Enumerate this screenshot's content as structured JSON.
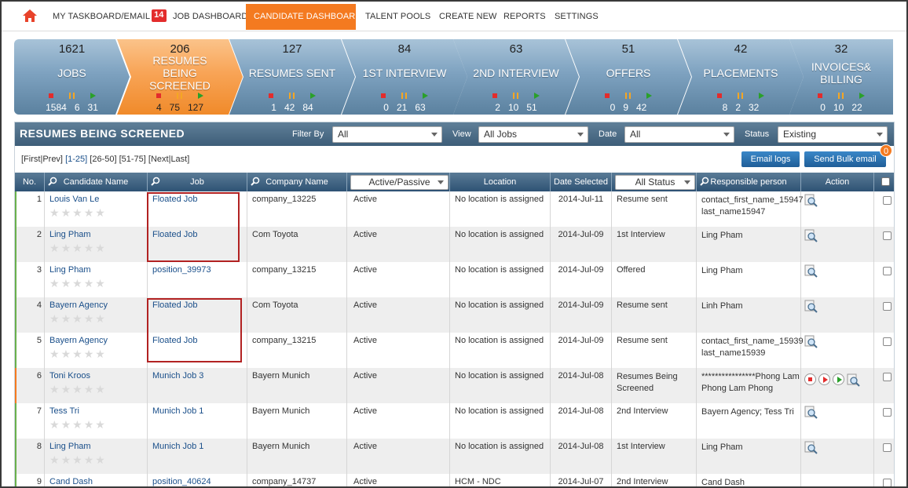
{
  "nav": {
    "items": [
      {
        "label": "MY TASKBOARD/EMAIL",
        "badge": "14"
      },
      {
        "label": "JOB DASHBOARD"
      },
      {
        "label": "CANDIDATE DASHBOARD"
      },
      {
        "label": "TALENT POOLS"
      },
      {
        "label": "CREATE NEW"
      },
      {
        "label": "REPORTS"
      },
      {
        "label": "SETTINGS"
      }
    ],
    "active_item": "CANDIDATE DASHBOARD",
    "accent_color": "#f47a20"
  },
  "pipeline": [
    {
      "count": "1621",
      "label": "JOBS",
      "stopped": "1584",
      "paused": "6",
      "running": "31"
    },
    {
      "count": "206",
      "label": "RESUMES BEING SCREENED",
      "stopped": "4",
      "paused": "75",
      "running": "127",
      "active": true
    },
    {
      "count": "127",
      "label": "RESUMES SENT",
      "stopped": "1",
      "paused": "42",
      "running": "84"
    },
    {
      "count": "84",
      "label": "1ST INTERVIEW",
      "stopped": "0",
      "paused": "21",
      "running": "63"
    },
    {
      "count": "63",
      "label": "2ND INTERVIEW",
      "stopped": "2",
      "paused": "10",
      "running": "51"
    },
    {
      "count": "51",
      "label": "OFFERS",
      "stopped": "0",
      "paused": "9",
      "running": "42"
    },
    {
      "count": "42",
      "label": "PLACEMENTS",
      "stopped": "8",
      "paused": "2",
      "running": "32"
    },
    {
      "count": "32",
      "label": "INVOICES& BILLING",
      "stopped": "0",
      "paused": "10",
      "running": "22"
    }
  ],
  "panel": {
    "title": "RESUMES BEING SCREENED",
    "filter_by_label": "Filter By",
    "filter_by_value": "All",
    "view_label": "View",
    "view_value": "All Jobs",
    "date_label": "Date",
    "date_value": "All",
    "status_label": "Status",
    "status_value": "Existing"
  },
  "pager": {
    "first": "[First",
    "sep": "|",
    "prev": "Prev]",
    "range1": "[1-25]",
    "range2": "[26-50]",
    "range3": "[51-75]",
    "next": "[Next",
    "last": "Last]"
  },
  "buttons": {
    "email_logs": "Email logs",
    "send_bulk_email": "Send Bulk email",
    "bulk_badge": "0"
  },
  "table": {
    "headers": {
      "no": "No.",
      "candidate": "Candidate Name",
      "job": "Job",
      "company": "Company Name",
      "active_passive": "Active/Passive",
      "location": "Location",
      "date_selected": "Date Selected",
      "all_status": "All Status",
      "responsible": "Responsible person",
      "action": "Action"
    },
    "rows": [
      {
        "no": "1",
        "candidate": "Louis Van Le",
        "job": "Floated Job",
        "company": "company_13225",
        "active": "Active",
        "location": "No location is assigned",
        "date": "2014-Jul-11",
        "status": "Resume sent",
        "responsible": "contact_first_name_15947 last_name15947"
      },
      {
        "no": "2",
        "candidate": "Ling Pham",
        "job": "Floated Job",
        "company": "Com Toyota",
        "active": "Active",
        "location": "No location is assigned",
        "date": "2014-Jul-09",
        "status": "1st Interview",
        "responsible": "Ling Pham"
      },
      {
        "no": "3",
        "candidate": "Ling Pham",
        "job": "position_39973",
        "company": "company_13215",
        "active": "Active",
        "location": "No location is assigned",
        "date": "2014-Jul-09",
        "status": "Offered",
        "responsible": "Ling Pham"
      },
      {
        "no": "4",
        "candidate": "Bayern Agency",
        "job": "Floated Job",
        "company": "Com Toyota",
        "active": "Active",
        "location": "No location is assigned",
        "date": "2014-Jul-09",
        "status": "Resume sent",
        "responsible": "Linh Pham"
      },
      {
        "no": "5",
        "candidate": "Bayern Agency",
        "job": "Floated Job",
        "company": "company_13215",
        "active": "Active",
        "location": "No location is assigned",
        "date": "2014-Jul-09",
        "status": "Resume sent",
        "responsible": "contact_first_name_15939 last_name15939"
      },
      {
        "no": "6",
        "candidate": "Toni Kroos",
        "job": "Munich Job 3",
        "company": "Bayern Munich",
        "active": "Active",
        "location": "No location is assigned",
        "date": "2014-Jul-08",
        "status": "Resumes Being Screened",
        "responsible": "****************Phong Lam Phong Lam Phong"
      },
      {
        "no": "7",
        "candidate": "Tess Tri",
        "job": "Munich Job 1",
        "company": "Bayern Munich",
        "active": "Active",
        "location": "No location is assigned",
        "date": "2014-Jul-08",
        "status": "2nd Interview",
        "responsible": "Bayern Agency; Tess Tri"
      },
      {
        "no": "8",
        "candidate": "Ling Pham",
        "job": "Munich Job 1",
        "company": "Bayern Munich",
        "active": "Active",
        "location": "No location is assigned",
        "date": "2014-Jul-08",
        "status": "1st Interview",
        "responsible": "Ling Pham"
      },
      {
        "no": "9",
        "candidate": "Cand Dash",
        "job": "position_40624",
        "company": "company_14737",
        "active": "Active",
        "location": "HCM - NDC",
        "date": "2014-Jul-07",
        "status": "2nd Interview",
        "responsible": "Cand Dash"
      }
    ]
  }
}
